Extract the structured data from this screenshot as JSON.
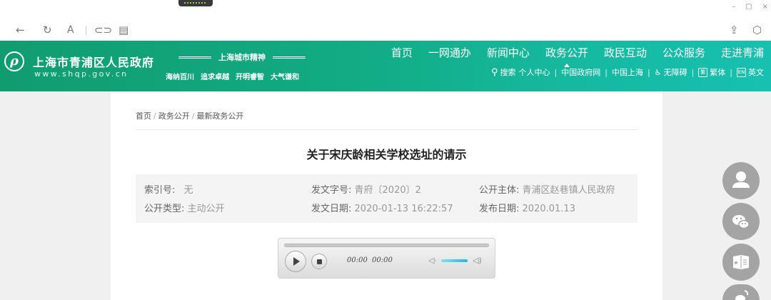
{
  "window": {
    "controls": [
      "–",
      "▢",
      "×"
    ]
  },
  "toolbar": {
    "reader_label": "A"
  },
  "header": {
    "logo_glyph": "ρ",
    "site_title": "上海市青浦区人民政府",
    "site_url": "www.shqp.gov.cn",
    "spirit_title": "上海城市精神",
    "spirit_items": [
      "海纳百川",
      "追求卓越",
      "开明睿智",
      "大气谦和"
    ],
    "nav": [
      "首页",
      "一网通办",
      "新闻中心",
      "政务公开",
      "政民互动",
      "公众服务",
      "走进青浦"
    ],
    "nav_active": "政务公开",
    "search_label": "搜索",
    "personal_center": "个人中心",
    "links": [
      "中国政府网",
      "中国上海"
    ],
    "accessibility": "无障碍",
    "traditional_badge": "繁",
    "traditional": "繁体",
    "english_badge": "EN",
    "english": "英文"
  },
  "breadcrumb": [
    "首页",
    "政务公开",
    "最新政务公开"
  ],
  "article": {
    "title": "关于宋庆龄相关学校选址的请示",
    "meta": {
      "index_label": "索引号:",
      "index_value": "无",
      "doc_no_label": "发文字号:",
      "doc_no_value": "青府〔2020〕2",
      "subject_label": "公开主体:",
      "subject_value": "青浦区赵巷镇人民政府",
      "type_label": "公开类型:",
      "type_value": "主动公开",
      "date_label": "发文日期:",
      "date_value": "2020-01-13 16:22:57",
      "publish_label": "发布日期:",
      "publish_value": "2020.01.13"
    }
  },
  "player": {
    "current_time": "00:00",
    "duration": "00:00"
  },
  "colors": {
    "header_start": "#119c6f",
    "header_end": "#17c0b0",
    "float_button": "#a4a4a4"
  }
}
